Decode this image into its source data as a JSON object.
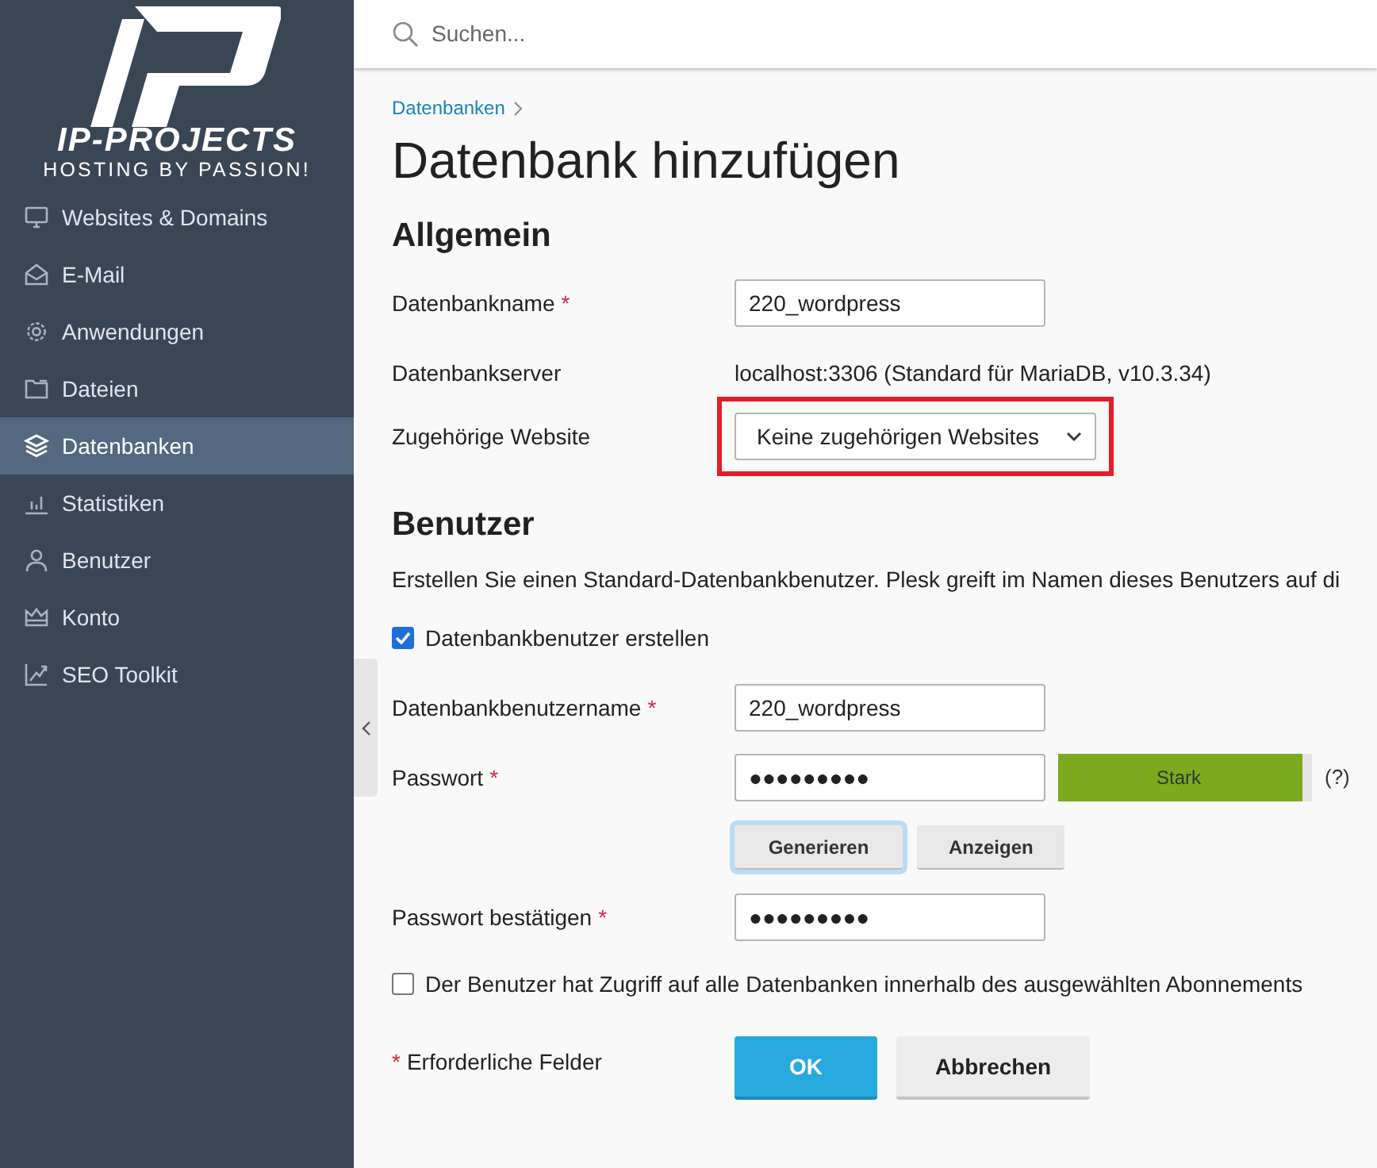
{
  "logo": {
    "name": "IP-PROJECTS",
    "tagline": "HOSTING BY PASSION!"
  },
  "sidebar": {
    "items": [
      {
        "label": "Websites & Domains",
        "selected": false
      },
      {
        "label": "E-Mail",
        "selected": false
      },
      {
        "label": "Anwendungen",
        "selected": false
      },
      {
        "label": "Dateien",
        "selected": false
      },
      {
        "label": "Datenbanken",
        "selected": true
      },
      {
        "label": "Statistiken",
        "selected": false
      },
      {
        "label": "Benutzer",
        "selected": false
      },
      {
        "label": "Konto",
        "selected": false
      },
      {
        "label": "SEO Toolkit",
        "selected": false
      }
    ]
  },
  "search": {
    "placeholder": "Suchen..."
  },
  "breadcrumb": [
    "Datenbanken"
  ],
  "title": "Datenbank hinzufügen",
  "general": {
    "heading": "Allgemein",
    "fields": [
      {
        "kind": "input",
        "label": "Datenbankname",
        "required_mark": "*",
        "value": "220_wordpress"
      },
      {
        "kind": "text",
        "label": "Datenbankserver",
        "value": "localhost:3306 (Standard für MariaDB, v10.3.34)"
      },
      {
        "kind": "select",
        "label": "Zugehörige Website",
        "value": "Keine zugehörigen Websites",
        "highlighted": true
      }
    ]
  },
  "user": {
    "heading": "Benutzer",
    "description": "Erstellen Sie einen Standard-Datenbankbenutzer. Plesk greift im Namen dieses Benutzers auf di",
    "create_user": {
      "label": "Datenbankbenutzer erstellen",
      "checked": true
    },
    "fields": [
      {
        "kind": "input",
        "label": "Datenbankbenutzername",
        "required_mark": "*",
        "value": "220_wordpress"
      },
      {
        "kind": "password",
        "label": "Passwort",
        "required_mark": "*",
        "value": "●●●●●●●●●",
        "strength": {
          "label": "Stark",
          "level": 0.96
        },
        "help": "(?)"
      },
      {
        "kind": "buttons",
        "buttons": [
          {
            "label": "Generieren",
            "focused": true
          },
          {
            "label": "Anzeigen",
            "focused": false
          }
        ]
      },
      {
        "kind": "password",
        "label": "Passwort bestätigen",
        "required_mark": "*",
        "value": "●●●●●●●●●"
      }
    ],
    "access_all": {
      "label": "Der Benutzer hat Zugriff auf alle Datenbanken innerhalb des ausgewählten Abonnements",
      "checked": false
    }
  },
  "footer": {
    "required_mark": "*",
    "note": "Erforderliche Felder",
    "buttons": [
      {
        "label": "OK",
        "kind": "primary"
      },
      {
        "label": "Abbrechen",
        "kind": "secondary"
      }
    ]
  }
}
